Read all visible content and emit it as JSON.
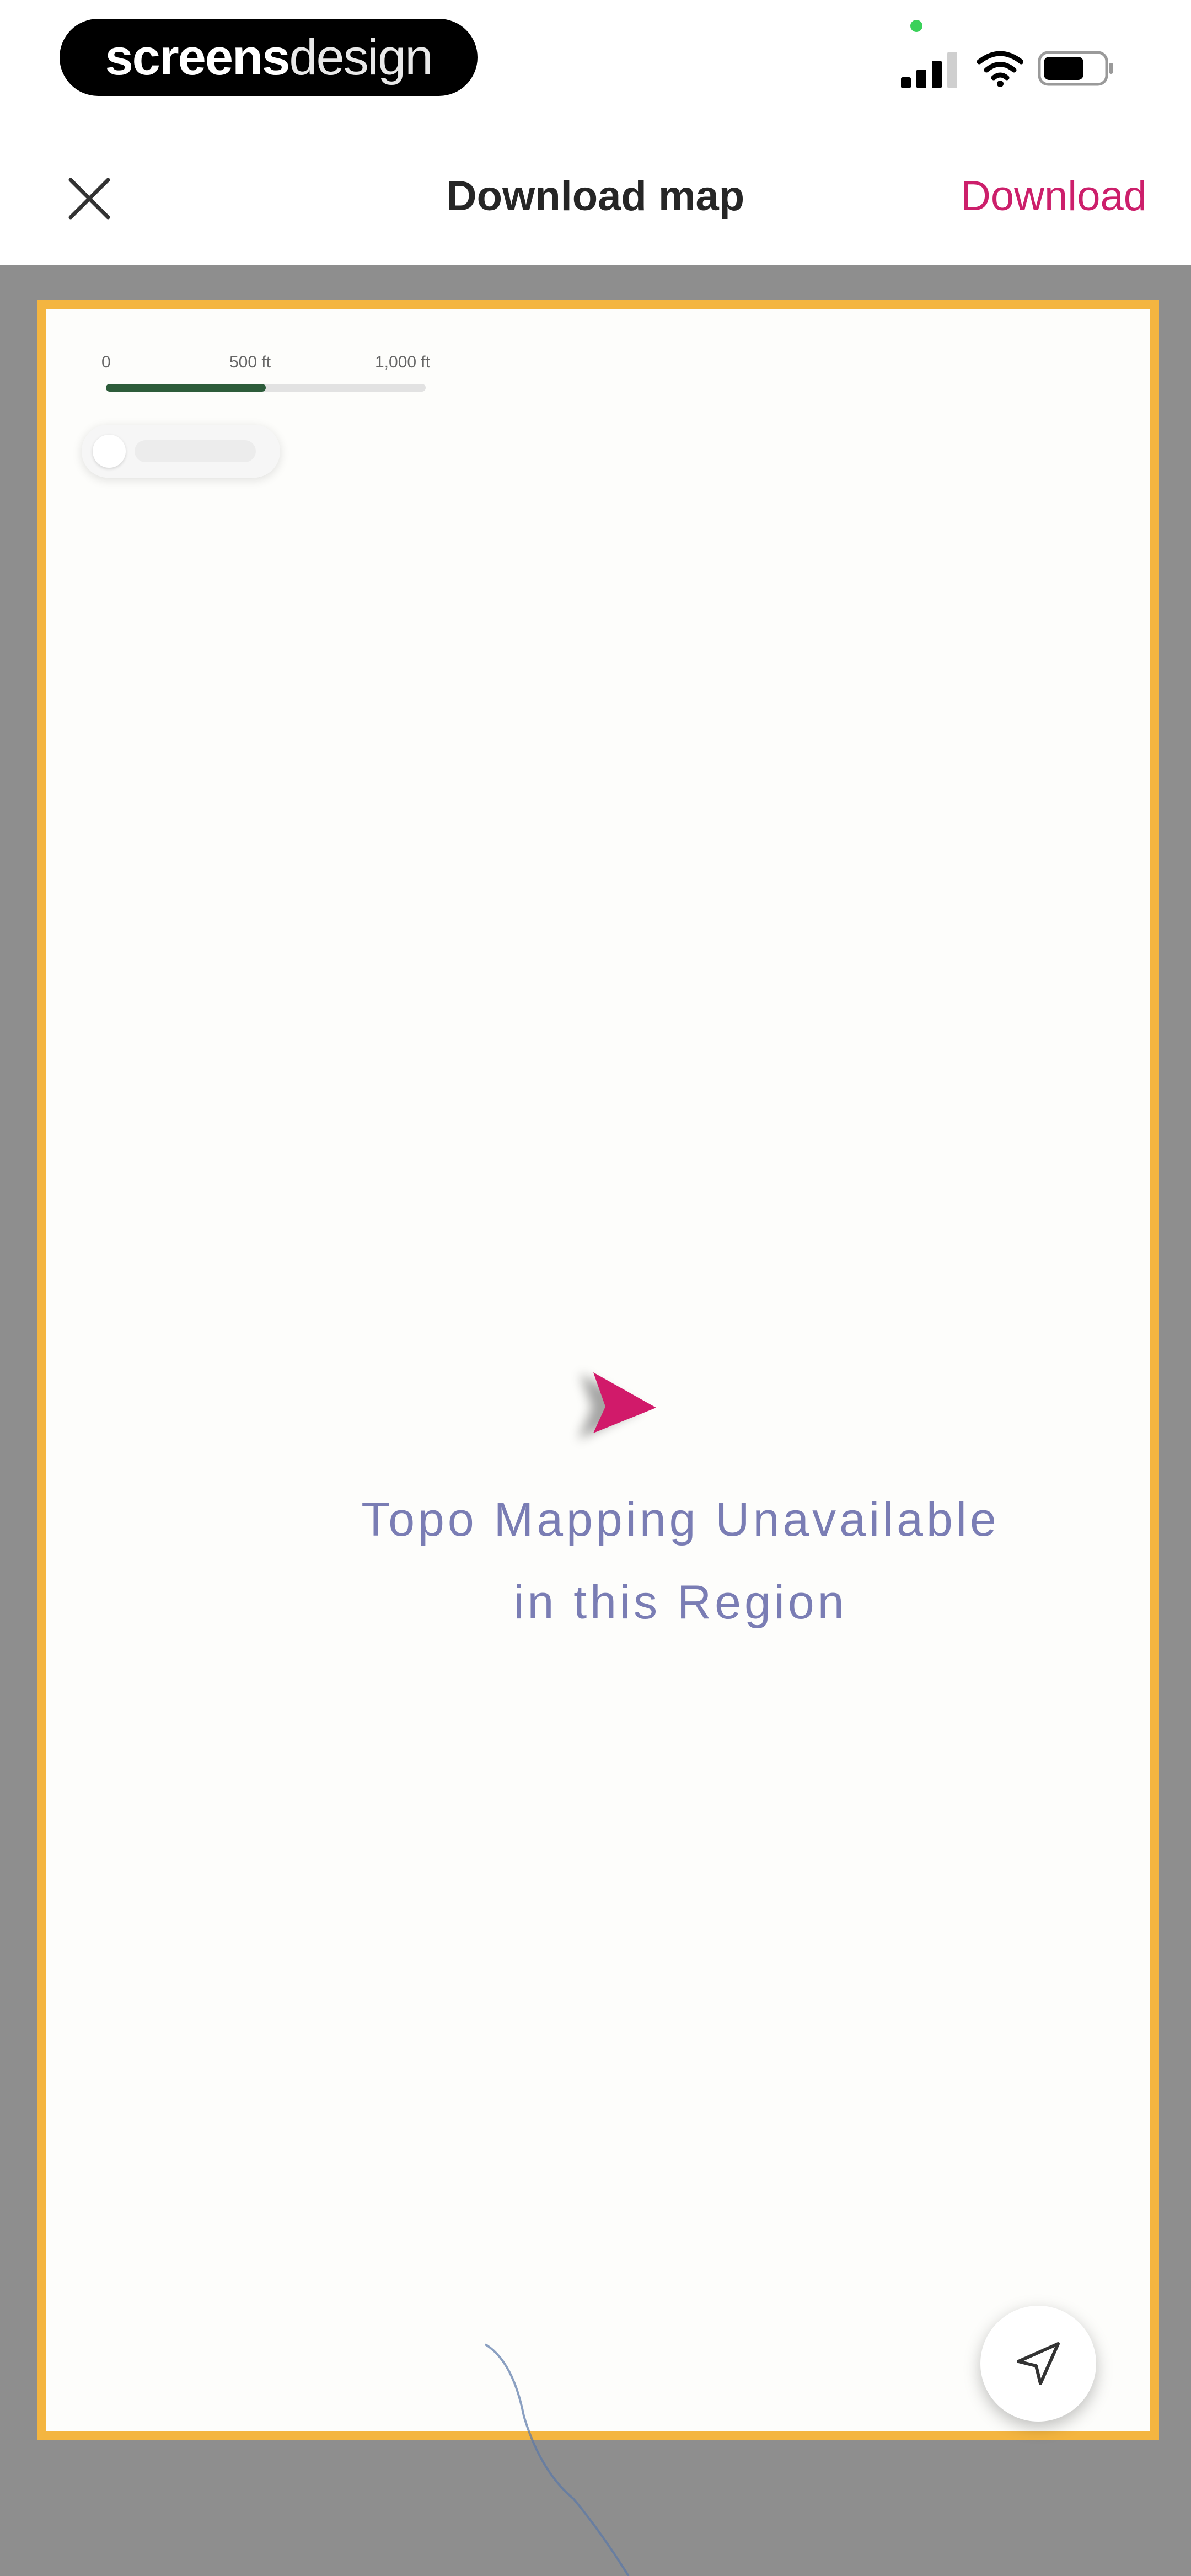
{
  "status_bar": {
    "brand_bold": "screens",
    "brand_light": "design",
    "signal_icon": "signal-bars-icon",
    "wifi_icon": "wifi-icon",
    "battery_icon": "battery-icon"
  },
  "header": {
    "title": "Download map",
    "download_label": "Download",
    "close_icon": "close-icon"
  },
  "map": {
    "scale_labels": [
      "0",
      "500 ft",
      "1,000 ft"
    ],
    "message_line1": "Topo Mapping Unavailable",
    "message_line2": "in this Region",
    "recenter_icon": "navigation-arrow-icon",
    "marker_icon": "location-marker-icon"
  },
  "colors": {
    "accent": "#cc1f6b",
    "frame_border": "#f4b540",
    "map_backdrop": "#8e8e8e",
    "message_text": "#7a7db4",
    "scale_fill": "#2d5c3a"
  }
}
